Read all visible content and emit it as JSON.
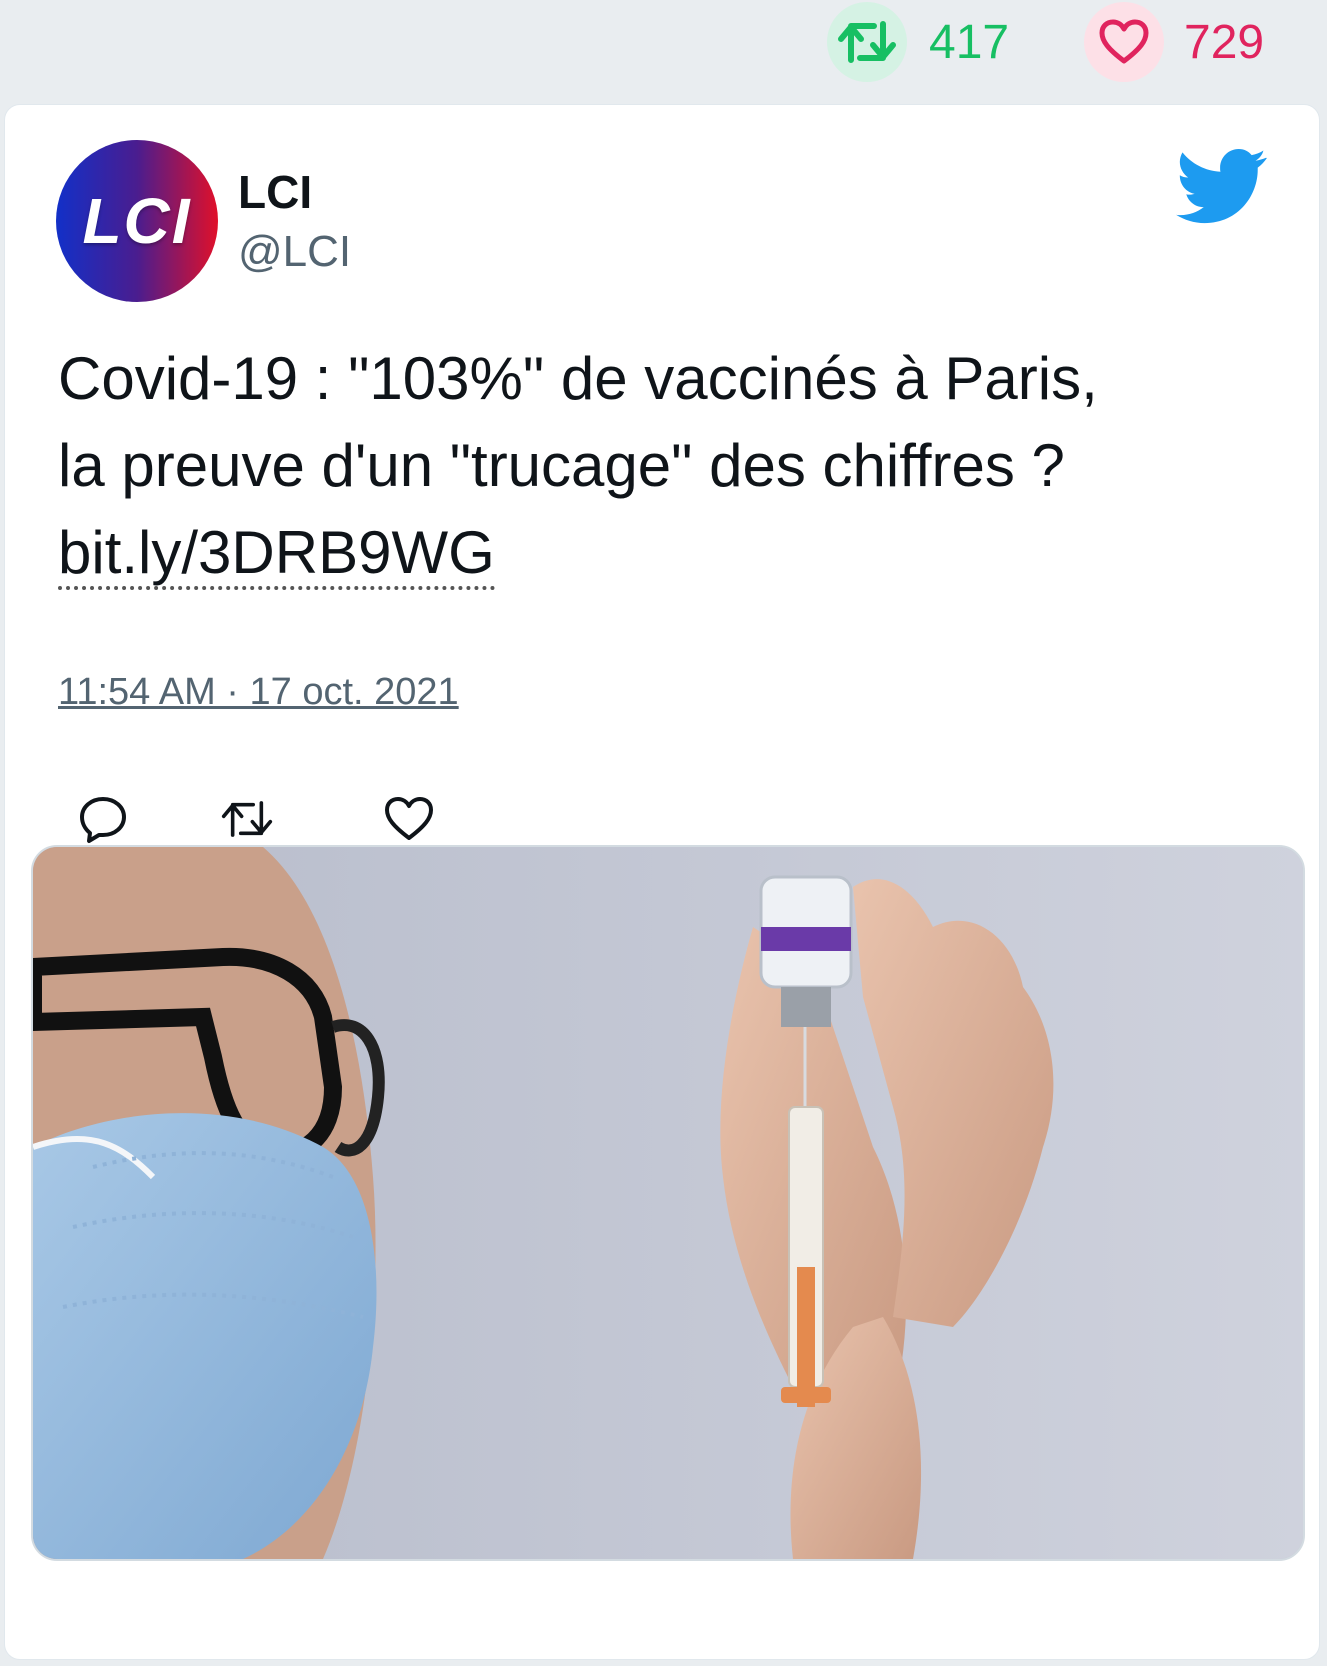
{
  "stats": {
    "retweets": "417",
    "likes": "729",
    "retweet_icon": "retweet-icon",
    "like_icon": "heart-icon",
    "colors": {
      "retweet": "#17bf63",
      "like": "#e0245e"
    }
  },
  "tweet": {
    "author_name": "LCI",
    "author_handle": "@LCI",
    "avatar_text": "LCI",
    "text_line1": "Covid-19 : \"103%\" de vaccinés à Paris,",
    "text_line2": "la preuve d'un \"trucage\" des chiffres ?",
    "link": "bit.ly/3DRB9WG",
    "timestamp": "11:54 AM · 17 oct. 2021",
    "brand_icon": "twitter-bird-icon",
    "brand_color": "#1d9bf0"
  },
  "actions": {
    "reply_icon": "reply-icon",
    "retweet_icon": "retweet-icon",
    "like_icon": "heart-icon"
  }
}
